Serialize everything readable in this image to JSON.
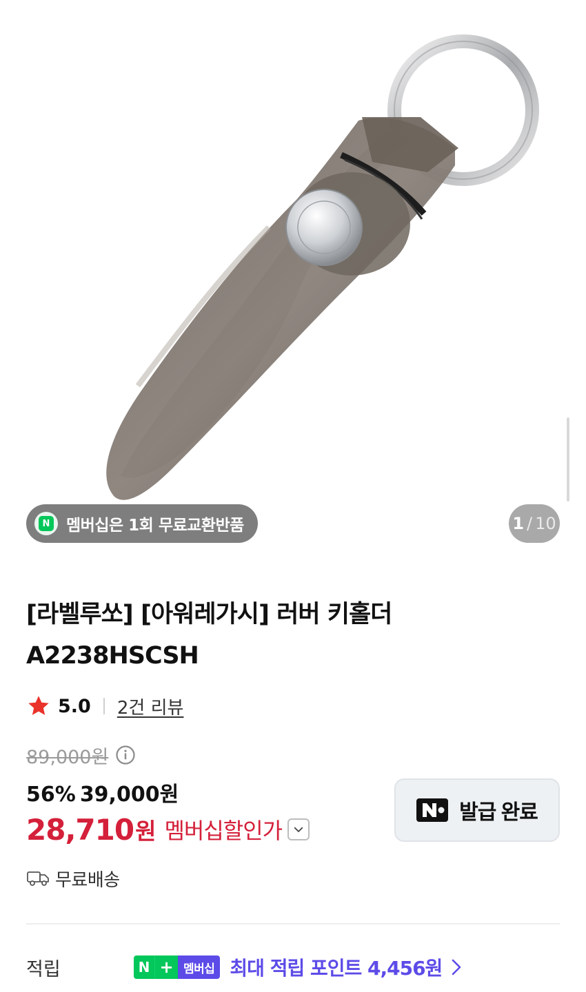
{
  "gallery": {
    "membership_badge_text": "멤버십은 1회 무료교환반품",
    "badge_n_letter": "N",
    "page_current": "1",
    "page_separator": "/",
    "page_total": "10"
  },
  "product": {
    "title": "[라벨루쏘] [아워레가시] 러버 키홀더 A2238HSCSH",
    "rating": "5.0",
    "review_link": "2건 리뷰",
    "original_price": "89,000원",
    "discount_rate": "56%",
    "sale_price": "39,000원",
    "member_price": "28,710",
    "member_price_unit": "원",
    "member_price_label": "멤버십할인가",
    "shipping": "무료배송"
  },
  "coupon": {
    "label": "발급 완료"
  },
  "points": {
    "label": "적립",
    "badge_n": "N",
    "badge_plus": "+",
    "badge_text": "멤버십",
    "text": "최대 적립 포인트 4,456원"
  },
  "colors": {
    "accent_red": "#d4203a",
    "naver_green": "#03c75a",
    "membership_purple": "#5d4be8"
  },
  "icons": [
    "star-icon",
    "info-icon",
    "chevron-down-icon",
    "naver-n-icon",
    "truck-icon",
    "chevron-right-icon"
  ]
}
